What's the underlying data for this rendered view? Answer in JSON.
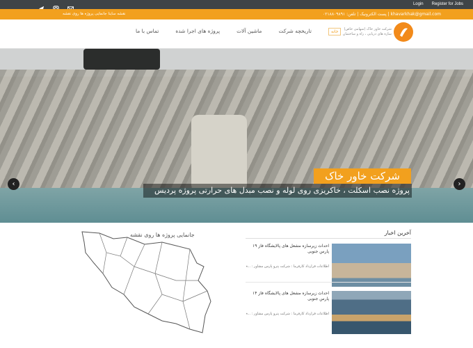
{
  "topbar": {
    "social_icons": [
      "telegram-icon",
      "instagram-icon",
      "email-icon"
    ],
    "login": "Login",
    "register": "Register for Jobs"
  },
  "orangebar": {
    "contact": "khavarkhak@gmail.com | پست الکترونیک | تلفن: ۰۲۱۸۸۰۹۸۹۱",
    "map_link": "نقشه ساینا جانمایی پروژه ها روی نقشه"
  },
  "header": {
    "brand_line1": "شرکت خاور خاک (سهامی خاص)",
    "brand_line2": "سازه های دریایی ، راه و ساختمان",
    "nav": [
      "خانه",
      "تاریخچه شرکت",
      "ماشین آلات",
      "پروژه های اجرا شده",
      "تماس با ما"
    ]
  },
  "hero": {
    "caption_title": "شرکت خاور خاک",
    "caption_subtitle": "پروژه نصب اسکلت ، خاکریزی روی لوله و نصب مبدل های حرارتی پروژه پردیس",
    "prev_icon": "chevron-left-icon",
    "next_icon": "chevron-right-icon"
  },
  "map_section": {
    "title": "جانمایی پروژه ها روی نقشه"
  },
  "news": {
    "title": "آخرین اخبار",
    "items": [
      {
        "title": "احداث زیرسازه مشعل های پالایشگاه فاز ۱۹ پارس جنوبی",
        "excerpt": "اطلاعات قرارداد کارفرما : شرکت پترو پارس مشاور : ..."
      },
      {
        "title": "احداث زیرسازه مشعل های پالایشگاه فاز ۱۴ پارس جنوبی",
        "excerpt": "اطلاعات قرارداد کارفرما : شرکت پترو پارس مشاور : ..."
      }
    ]
  },
  "colors": {
    "orange": "#f2a01e",
    "dark": "#3f4447"
  }
}
